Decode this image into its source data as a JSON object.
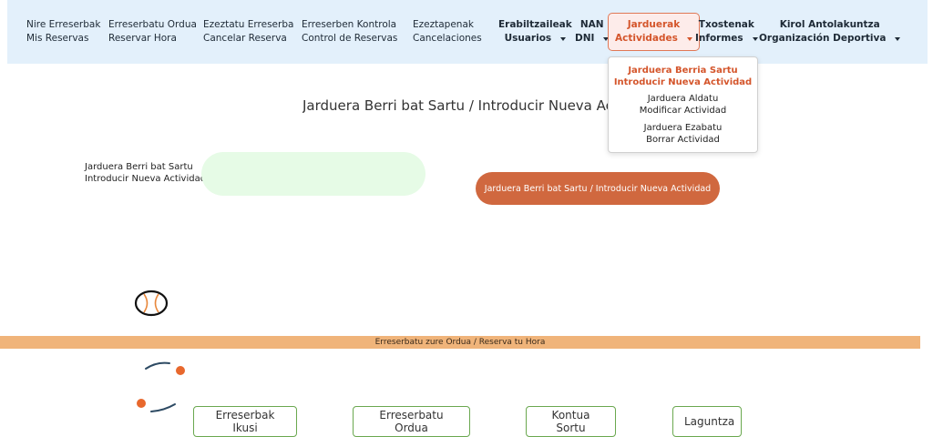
{
  "nav": {
    "items": [
      {
        "l1": "Nire Erreserbak",
        "l2": "Mis Reservas"
      },
      {
        "l1": "Erreserbatu Ordua",
        "l2": "Reservar Hora"
      },
      {
        "l1": "Ezeztatu Erreserba",
        "l2": "Cancelar Reserva"
      },
      {
        "l1": "Erreserben Kontrola",
        "l2": "Control de Reservas"
      },
      {
        "l1": "Ezeztapenak",
        "l2": "Cancelaciones"
      },
      {
        "l1": "Erabiltzaileak",
        "l2": "Usuarios"
      },
      {
        "l1": "NAN",
        "l2": "DNI"
      },
      {
        "l1": "Jarduerak",
        "l2": "Actividades"
      },
      {
        "l1": "Txostenak",
        "l2": "Informes"
      },
      {
        "l1": "Kirol Antolakuntza",
        "l2": "Organización Deportiva"
      }
    ]
  },
  "dropdown": {
    "items": [
      {
        "l1": "Jarduera Berria Sartu",
        "l2": "Introducir Nueva Actividad"
      },
      {
        "l1": "Jarduera Aldatu",
        "l2": "Modificar Actividad"
      },
      {
        "l1": "Jarduera Ezabatu",
        "l2": "Borrar Actividad"
      }
    ]
  },
  "page": {
    "title": "Jarduera Berri bat Sartu / Introducir Nueva Actividad"
  },
  "form": {
    "label_l1": "Jarduera Berri bat Sartu",
    "label_l2": "Introducir Nueva Actividad:",
    "input_value": "",
    "submit_label": "Jarduera Berri bat Sartu / Introducir Nueva Actividad"
  },
  "footer": {
    "bar_text": "Erreserbatu zure Ordua / Reserva tu Hora",
    "buttons": [
      "Erreserbak Ikusi",
      "Erreserbatu Ordua",
      "Kontua Sortu",
      "Laguntza"
    ]
  },
  "colors": {
    "navbar_bg": "#e3f0fb",
    "accent": "#d0683f",
    "input_bg": "#e6fbe6",
    "footer_bar": "#f0b47a",
    "button_border": "#6aa84f"
  }
}
